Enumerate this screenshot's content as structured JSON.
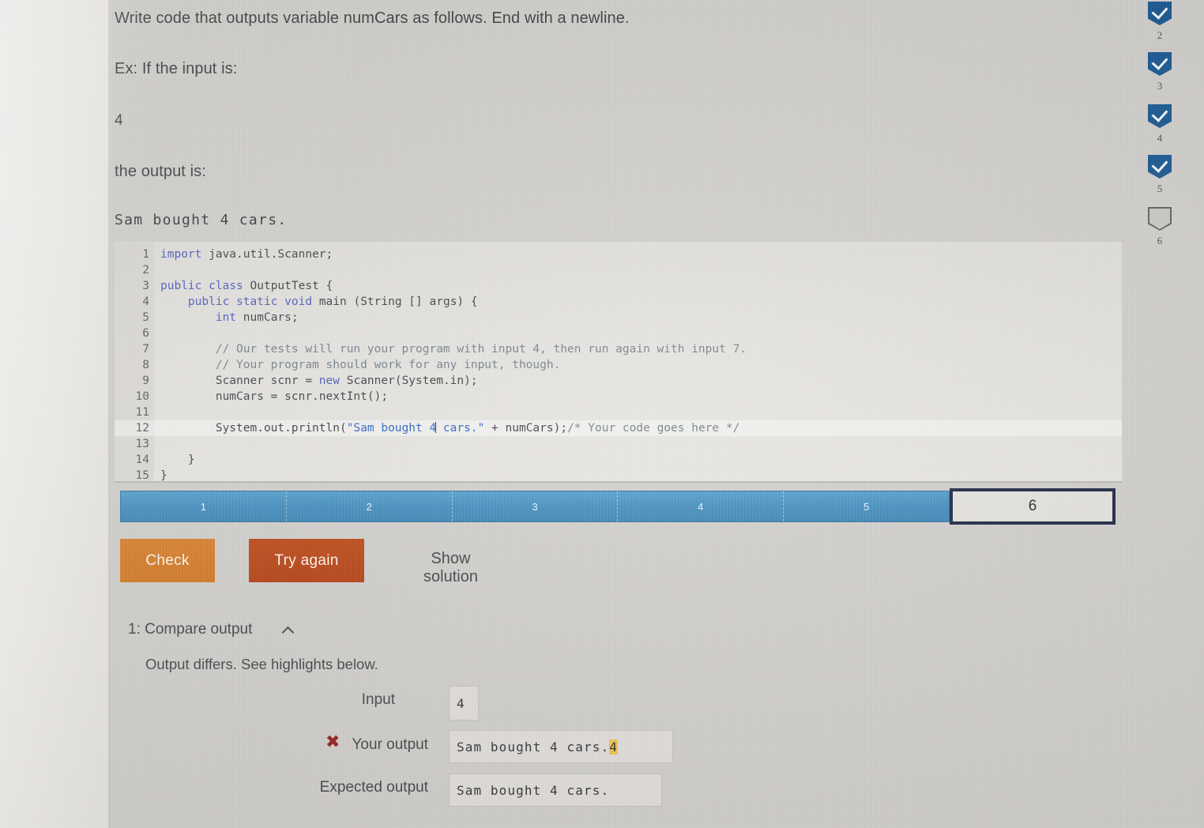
{
  "prompt": {
    "line1": "Write code that outputs variable numCars as follows. End with a newline.",
    "line2": "Ex: If the input is:",
    "line3": "4",
    "line4": "the output is:",
    "example_output": "Sam bought 4 cars."
  },
  "editor": {
    "lines": [
      {
        "num": "1",
        "tokens": [
          {
            "t": "import",
            "c": "kw"
          },
          {
            "t": " java.util.Scanner;",
            "c": "plain"
          }
        ]
      },
      {
        "num": "2",
        "tokens": []
      },
      {
        "num": "3",
        "tokens": [
          {
            "t": "public",
            "c": "kw"
          },
          {
            "t": " ",
            "c": "plain"
          },
          {
            "t": "class",
            "c": "kw"
          },
          {
            "t": " OutputTest {",
            "c": "plain"
          }
        ]
      },
      {
        "num": "4",
        "tokens": [
          {
            "t": "    ",
            "c": "plain"
          },
          {
            "t": "public",
            "c": "kw"
          },
          {
            "t": " ",
            "c": "plain"
          },
          {
            "t": "static",
            "c": "kw"
          },
          {
            "t": " ",
            "c": "plain"
          },
          {
            "t": "void",
            "c": "kw"
          },
          {
            "t": " main (String [] args) {",
            "c": "plain"
          }
        ]
      },
      {
        "num": "5",
        "tokens": [
          {
            "t": "        ",
            "c": "plain"
          },
          {
            "t": "int",
            "c": "kw"
          },
          {
            "t": " numCars;",
            "c": "plain"
          }
        ]
      },
      {
        "num": "6",
        "tokens": []
      },
      {
        "num": "7",
        "tokens": [
          {
            "t": "        // Our tests will run your program with input 4, then run again with input 7.",
            "c": "cmt"
          }
        ]
      },
      {
        "num": "8",
        "tokens": [
          {
            "t": "        // Your program should work for any input, though.",
            "c": "cmt"
          }
        ]
      },
      {
        "num": "9",
        "tokens": [
          {
            "t": "        Scanner scnr = ",
            "c": "plain"
          },
          {
            "t": "new",
            "c": "kw"
          },
          {
            "t": " Scanner(System.in);",
            "c": "plain"
          }
        ]
      },
      {
        "num": "10",
        "tokens": [
          {
            "t": "        numCars = scnr.nextInt();",
            "c": "plain"
          }
        ]
      },
      {
        "num": "11",
        "tokens": []
      },
      {
        "num": "12",
        "active": true,
        "tokens": [
          {
            "t": "        System.out.println(",
            "c": "plain"
          },
          {
            "t": "\"Sam bought 4",
            "c": "str"
          },
          {
            "t": "",
            "c": "caret"
          },
          {
            "t": " cars.\"",
            "c": "str"
          },
          {
            "t": " + numCars);",
            "c": "plain"
          },
          {
            "t": "/* Your code goes here */",
            "c": "cmt"
          }
        ]
      },
      {
        "num": "13",
        "tokens": []
      },
      {
        "num": "14",
        "tokens": [
          {
            "t": "    }",
            "c": "plain"
          }
        ]
      },
      {
        "num": "15",
        "tokens": [
          {
            "t": "}",
            "c": "plain"
          }
        ]
      }
    ]
  },
  "progress": {
    "segments": [
      "1",
      "2",
      "3",
      "4",
      "5"
    ],
    "current": "6",
    "fill_color": "#4089bb",
    "current_border_color": "#1b2440"
  },
  "actions": {
    "check_label": "Check",
    "try_again_label": "Try again",
    "show_solution_label": "Show solution",
    "check_color": "#cf7421",
    "try_again_color": "#b23f12"
  },
  "results": {
    "title": "1: Compare output",
    "chevron_icon": "chevron-up-icon",
    "subtitle": "Output differs. See highlights below.",
    "input_label": "Input",
    "input_value": "4",
    "your_output_label": "Your output",
    "your_output_icon": "x-mark-icon",
    "your_output_value": "Sam bought 4 cars.",
    "your_output_highlight": "4",
    "expected_output_label": "Expected output",
    "expected_output_value": "Sam bought 4 cars.",
    "highlight_color": "#f0c24a",
    "x_color": "#96201d"
  },
  "sidebar": {
    "badges": [
      {
        "num": "2",
        "state": "done"
      },
      {
        "num": "3",
        "state": "done"
      },
      {
        "num": "4",
        "state": "done"
      },
      {
        "num": "5",
        "state": "done"
      },
      {
        "num": "6",
        "state": "current"
      }
    ],
    "done_color": "#18558f"
  }
}
